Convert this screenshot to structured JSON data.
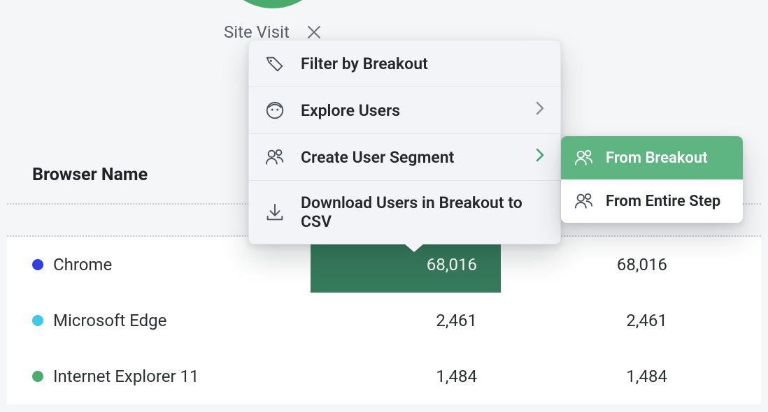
{
  "step": {
    "label": "Site Visit"
  },
  "menu": {
    "filter_label": "Filter by Breakout",
    "explore_label": "Explore Users",
    "segment_label": "Create User Segment",
    "download_label": "Download Users in Breakout to CSV"
  },
  "submenu": {
    "from_breakout": "From Breakout",
    "from_entire_step": "From Entire Step"
  },
  "table": {
    "header": "Browser Name",
    "rows": [
      {
        "label": "Chrome",
        "color": "#2f3fe0",
        "v1": "68,016",
        "v2": "68,016",
        "highlight": true
      },
      {
        "label": "Microsoft Edge",
        "color": "#3fc9e6",
        "v1": "2,461",
        "v2": "2,461",
        "highlight": false
      },
      {
        "label": "Internet Explorer 11",
        "color": "#4bab6f",
        "v1": "1,484",
        "v2": "1,484",
        "highlight": false
      }
    ]
  }
}
